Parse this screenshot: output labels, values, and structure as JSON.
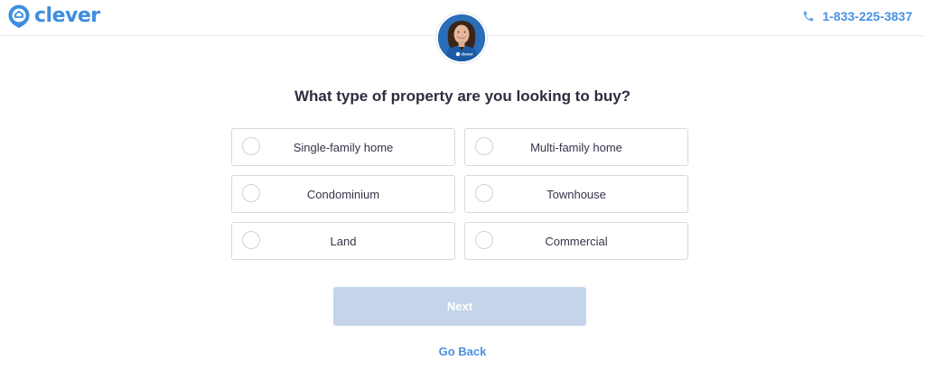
{
  "header": {
    "brand": "clever",
    "phone": "1-833-225-3837"
  },
  "avatar": {
    "badge_text": "clever"
  },
  "question": "What type of property are you looking to buy?",
  "options": [
    {
      "label": "Single-family home"
    },
    {
      "label": "Multi-family home"
    },
    {
      "label": "Condominium"
    },
    {
      "label": "Townhouse"
    },
    {
      "label": "Land"
    },
    {
      "label": "Commercial"
    }
  ],
  "actions": {
    "next_label": "Next",
    "back_label": "Go Back"
  },
  "colors": {
    "brand": "#3d8ee0",
    "link": "#4a90e2",
    "next_disabled": "#c4d5ea",
    "border": "#d5d9e0"
  }
}
